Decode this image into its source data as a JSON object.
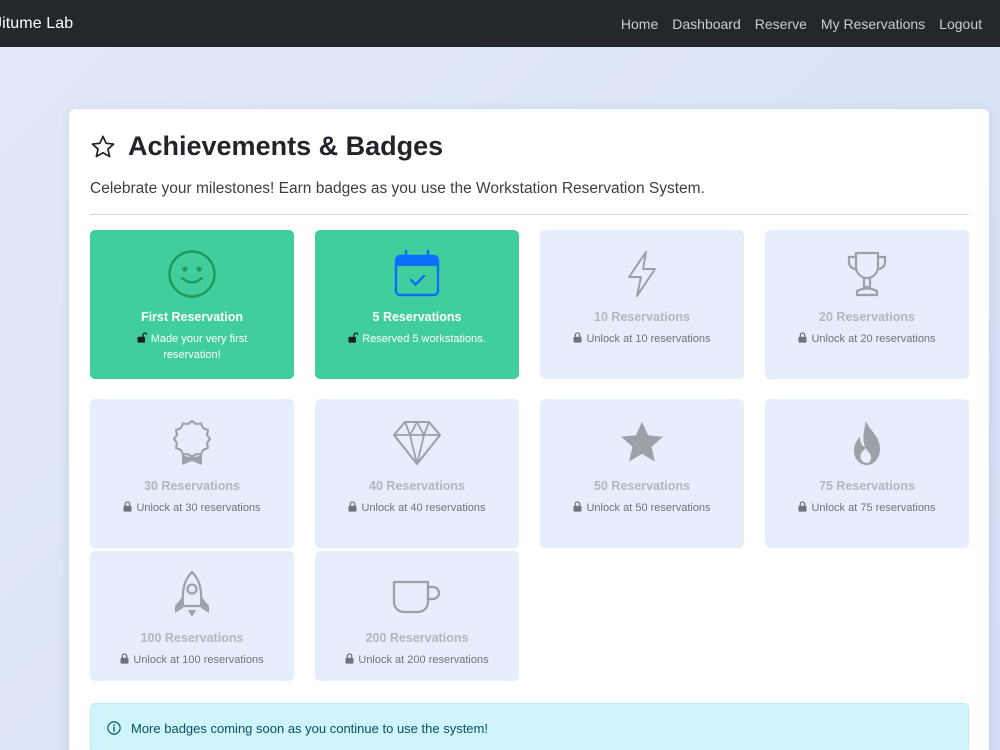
{
  "navbar": {
    "brand": "Jitume Lab",
    "links": [
      "Home",
      "Dashboard",
      "Reserve",
      "My Reservations",
      "Logout"
    ]
  },
  "page": {
    "title": "Achievements & Badges",
    "subtitle": "Celebrate your milestones! Earn badges as you use the Workstation Reservation System."
  },
  "badges": [
    {
      "title": "First Reservation",
      "desc": "Made your very first reservation!",
      "earned": true,
      "icon": "smile-icon"
    },
    {
      "title": "5 Reservations",
      "desc": "Reserved 5 workstations.",
      "earned": true,
      "icon": "calendar-check-icon"
    },
    {
      "title": "10 Reservations",
      "desc": "Unlock at 10 reservations",
      "earned": false,
      "icon": "lightning-icon"
    },
    {
      "title": "20 Reservations",
      "desc": "Unlock at 20 reservations",
      "earned": false,
      "icon": "trophy-icon"
    },
    {
      "title": "30 Reservations",
      "desc": "Unlock at 30 reservations",
      "earned": false,
      "icon": "award-icon"
    },
    {
      "title": "40 Reservations",
      "desc": "Unlock at 40 reservations",
      "earned": false,
      "icon": "gem-icon"
    },
    {
      "title": "50 Reservations",
      "desc": "Unlock at 50 reservations",
      "earned": false,
      "icon": "star-icon"
    },
    {
      "title": "75 Reservations",
      "desc": "Unlock at 75 reservations",
      "earned": false,
      "icon": "fire-icon"
    },
    {
      "title": "100 Reservations",
      "desc": "Unlock at 100 reservations",
      "earned": false,
      "icon": "rocket-icon"
    },
    {
      "title": "200 Reservations",
      "desc": "Unlock at 200 reservations",
      "earned": false,
      "icon": "cup-icon"
    }
  ],
  "info": {
    "text": "More badges coming soon as you continue to use the system!",
    "icon": "info-circle-icon"
  },
  "colors": {
    "navbar": "#24282c",
    "earned": "#40cf9c",
    "locked": "#e6edfb",
    "earned_icon_smile": "#1f9a5c",
    "earned_icon_calendar": "#0d6efd",
    "locked_icon": "#9ca1a7"
  }
}
